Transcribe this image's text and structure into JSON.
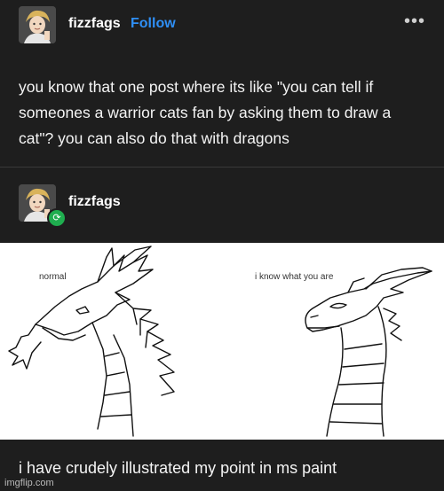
{
  "post": {
    "username": "fizzfags",
    "follow_label": "Follow",
    "more_label": "•••",
    "text": "you know that one post where its like \"you can tell if someones a warrior cats fan by asking them to draw a cat\"? you can also do that with dragons"
  },
  "reblog": {
    "username": "fizzfags",
    "badge_icon": "reblog-icon",
    "drawing": {
      "left_label": "normal",
      "right_label": "i know what you are"
    },
    "caption": "i have crudely illustrated my point in ms paint"
  },
  "watermark": "imgflip.com",
  "colors": {
    "background": "#1e1e1e",
    "accent": "#2f8ff5",
    "reblog_badge": "#1fae4f"
  }
}
